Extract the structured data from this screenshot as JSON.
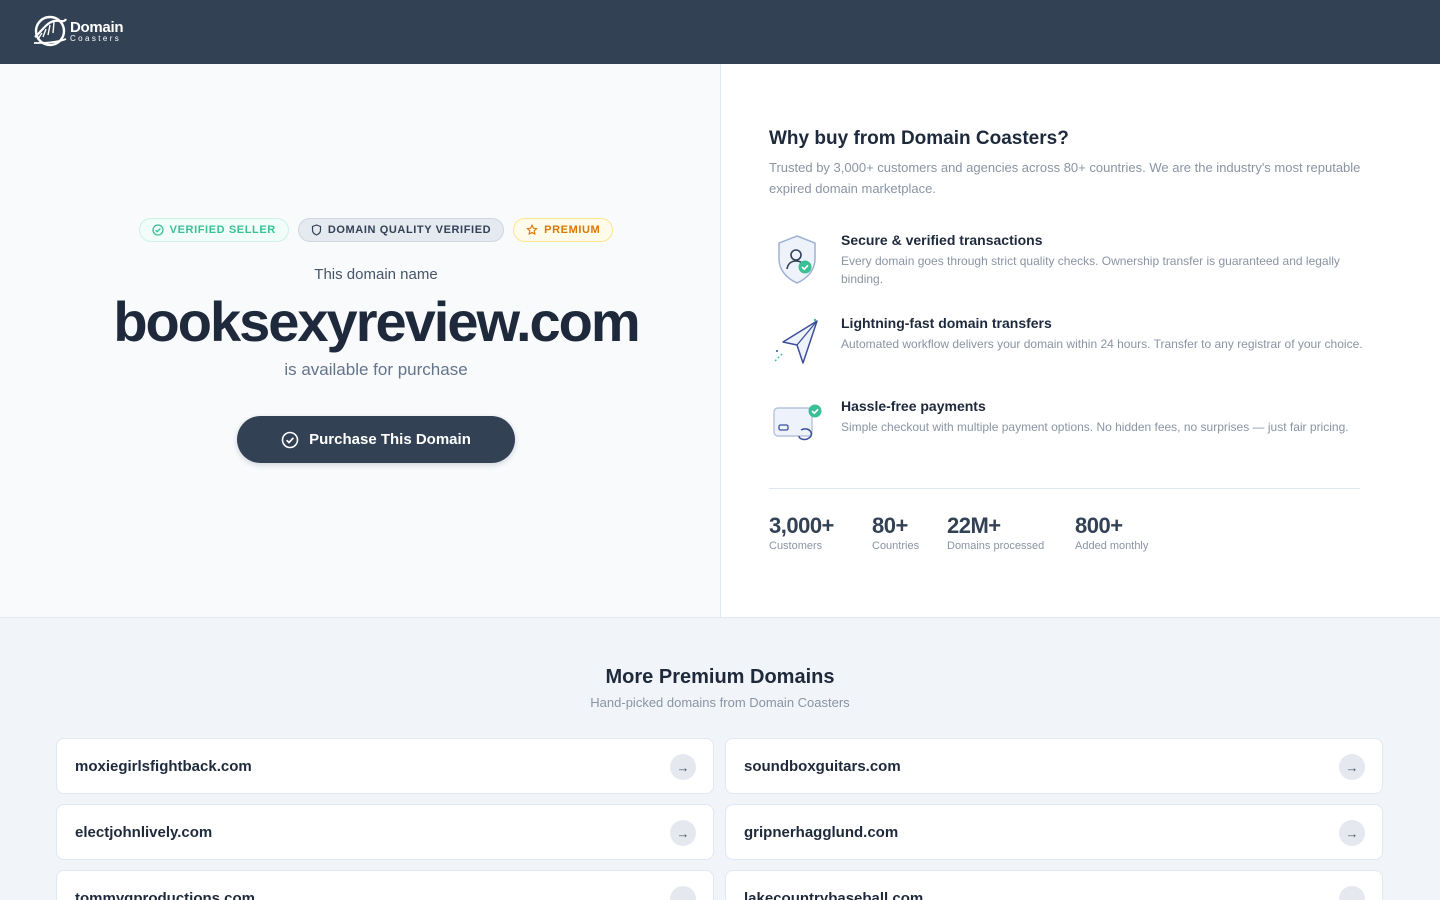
{
  "header": {
    "logo_line1": "Domain",
    "logo_line2": "Coasters",
    "background": "#334155"
  },
  "hero": {
    "badges": [
      {
        "label": "VERIFIED SELLER",
        "icon": "check-circle-icon",
        "color": "#3dbf96"
      },
      {
        "label": "DOMAIN QUALITY VERIFIED",
        "icon": "shield-icon",
        "color": "#334155"
      },
      {
        "label": "PREMIUM",
        "icon": "star-icon",
        "color": "#d97706"
      }
    ],
    "label": "This domain name",
    "domain": "booksexyreview.com",
    "availability": "is available for purchase",
    "button_label": "Purchase This Domain",
    "button_icon": "check-circle-icon"
  },
  "why": {
    "title": "Why buy from Domain Coasters?",
    "subtitle": "Trusted by 3,000+ customers and agencies across 80+ countries. We are the industry's most reputable expired domain marketplace.",
    "features": [
      {
        "icon": "secure-user-shield-icon",
        "title": "Secure & verified transactions",
        "description": "Every domain goes through strict quality checks. Ownership transfer is guaranteed and legally binding."
      },
      {
        "icon": "paper-plane-icon",
        "title": "Lightning-fast domain transfers",
        "description": "Automated workflow delivers your domain within 24 hours. Transfer to any registrar of your choice."
      },
      {
        "icon": "payment-card-icon",
        "title": "Hassle-free payments",
        "description": "Simple checkout with multiple payment options. No hidden fees, no surprises — just fair pricing."
      }
    ],
    "stats": [
      {
        "value": "3,000+",
        "label": "Customers"
      },
      {
        "value": "80+",
        "label": "Countries"
      },
      {
        "value": "22M+",
        "label": "Domains processed"
      },
      {
        "value": "800+",
        "label": "Added monthly"
      }
    ]
  },
  "more": {
    "title": "More Premium Domains",
    "subtitle": "Hand-picked domains from Domain Coasters",
    "arrow": "→",
    "domains": [
      "moxiegirlsfightback.com",
      "soundboxguitars.com",
      "electjohnlively.com",
      "gripnerhagglund.com",
      "tommyqproductions.com",
      "lakecountrybaseball.com"
    ]
  }
}
